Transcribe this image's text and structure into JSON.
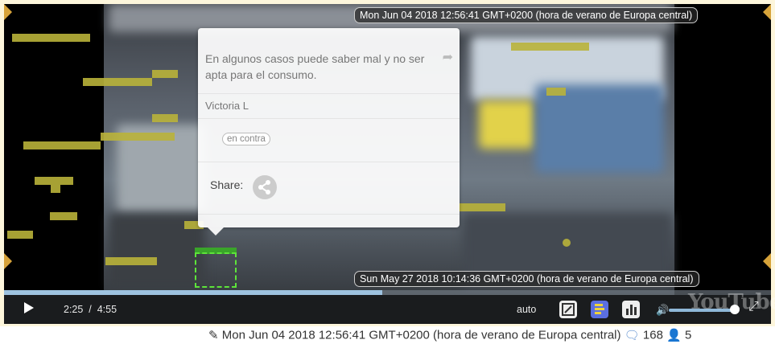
{
  "timestamps": {
    "top": "Mon Jun 04 2018 12:56:41 GMT+0200 (hora de verano de Europa central)",
    "bottom": "Sun May 27 2018 10:14:36 GMT+0200 (hora de verano de Europa central)"
  },
  "popup": {
    "text": "En algunos casos puede saber mal y no ser apta para el consumo.",
    "author": "Victoria L",
    "tag": "en contra",
    "share_label": "Share:"
  },
  "player": {
    "current_time": "2:25",
    "separator": "/",
    "duration": "4:55",
    "quality": "auto",
    "progress": 0.493,
    "watermark": "YouTube"
  },
  "footer": {
    "date": "Mon Jun 04 2018 12:56:41 GMT+0200 (hora de verano de Europa central)",
    "comments": "168",
    "users": "5"
  },
  "colors": {
    "accent": "#5de43a",
    "marker": "#b9b23a",
    "progress": "#9ec3e0"
  }
}
